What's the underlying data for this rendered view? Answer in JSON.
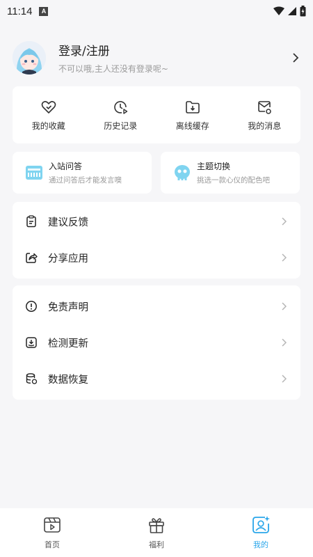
{
  "status_bar": {
    "time": "11:14",
    "badge": "A"
  },
  "profile": {
    "title": "登录/注册",
    "subtitle": "不可以哦,主人还没有登录呢~"
  },
  "quick_actions": [
    {
      "label": "我的收藏",
      "icon": "heart-check-icon"
    },
    {
      "label": "历史记录",
      "icon": "history-icon"
    },
    {
      "label": "离线缓存",
      "icon": "download-folder-icon"
    },
    {
      "label": "我的消息",
      "icon": "message-icon"
    }
  ],
  "features": [
    {
      "title": "入站问答",
      "subtitle": "通过问答后才能发言噢",
      "icon": "quiz-icon"
    },
    {
      "title": "主题切换",
      "subtitle": "挑选一款心仪的配色吧",
      "icon": "theme-icon"
    }
  ],
  "list_a": [
    {
      "label": "建议反馈",
      "icon": "feedback-icon"
    },
    {
      "label": "分享应用",
      "icon": "share-icon"
    }
  ],
  "list_b": [
    {
      "label": "免责声明",
      "icon": "disclaimer-icon"
    },
    {
      "label": "检测更新",
      "icon": "update-icon"
    },
    {
      "label": "数据恢复",
      "icon": "restore-icon"
    }
  ],
  "bottom_nav": [
    {
      "label": "首页",
      "icon": "home-video-icon"
    },
    {
      "label": "福利",
      "icon": "gift-icon"
    },
    {
      "label": "我的",
      "icon": "profile-icon",
      "active": true
    }
  ],
  "colors": {
    "accent": "#2aa6ea",
    "background": "#f6f6f8",
    "card": "#ffffff"
  }
}
